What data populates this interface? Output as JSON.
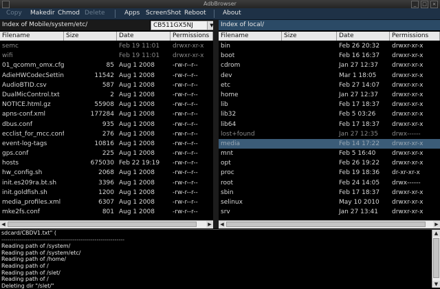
{
  "window": {
    "title": "AdbBrowser"
  },
  "menu": {
    "copy": "Copy",
    "makedir": "Makedir",
    "chmod": "Chmod",
    "delete": "Delete",
    "apps": "Apps",
    "screenshot": "ScreenShot",
    "reboot": "Reboot",
    "about": "About"
  },
  "left": {
    "path": "Index of Mobile/system/etc/",
    "device": "CB511GX5NJ",
    "headers": {
      "filename": "Filename",
      "size": "Size",
      "date": "Date",
      "permissions": "Permissions"
    },
    "rows": [
      {
        "name": "semc",
        "size": "",
        "date": "Feb 19 11:01",
        "perm": "drwxr-xr-x",
        "dim": true
      },
      {
        "name": "wifi",
        "size": "",
        "date": "Feb 19 11:01",
        "perm": "drwxr-xr-x",
        "dim": true
      },
      {
        "name": "01_qcomm_omx.cfg",
        "size": "85",
        "date": "Aug  1  2008",
        "perm": "-rw-r--r--"
      },
      {
        "name": "AdieHWCodecSetting",
        "size": "11542",
        "date": "Aug  1  2008",
        "perm": "-rw-r--r--"
      },
      {
        "name": "AudioBTID.csv",
        "size": "587",
        "date": "Aug  1  2008",
        "perm": "-rw-r--r--"
      },
      {
        "name": "DualMicControl.txt",
        "size": "2",
        "date": "Aug  1  2008",
        "perm": "-rw-r--r--"
      },
      {
        "name": "NOTICE.html.gz",
        "size": "55908",
        "date": "Aug  1  2008",
        "perm": "-rw-r--r--"
      },
      {
        "name": "apns-conf.xml",
        "size": "177284",
        "date": "Aug  1  2008",
        "perm": "-rw-r--r--"
      },
      {
        "name": "dbus.conf",
        "size": "935",
        "date": "Aug  1  2008",
        "perm": "-rw-r--r--"
      },
      {
        "name": "ecclist_for_mcc.conf",
        "size": "276",
        "date": "Aug  1  2008",
        "perm": "-rw-r--r--"
      },
      {
        "name": "event-log-tags",
        "size": "10816",
        "date": "Aug  1  2008",
        "perm": "-rw-r--r--"
      },
      {
        "name": "gps.conf",
        "size": "225",
        "date": "Aug  1  2008",
        "perm": "-rw-r--r--"
      },
      {
        "name": "hosts",
        "size": "675030",
        "date": "Feb 22 19:19",
        "perm": "-rw-r--r--"
      },
      {
        "name": "hw_config.sh",
        "size": "2068",
        "date": "Aug  1  2008",
        "perm": "-rw-r--r--"
      },
      {
        "name": "init.es209ra.bt.sh",
        "size": "3396",
        "date": "Aug  1  2008",
        "perm": "-rw-r--r--"
      },
      {
        "name": "init.goldfish.sh",
        "size": "1200",
        "date": "Aug  1  2008",
        "perm": "-rw-r--r--"
      },
      {
        "name": "media_profiles.xml",
        "size": "6307",
        "date": "Aug  1  2008",
        "perm": "-rw-r--r--"
      },
      {
        "name": "mke2fs.conf",
        "size": "801",
        "date": "Aug  1  2008",
        "perm": "-rw-r--r--"
      }
    ]
  },
  "right": {
    "path": "Index of local/",
    "headers": {
      "filename": "Filename",
      "size": "Size",
      "date": "Date",
      "permissions": "Permissions"
    },
    "rows": [
      {
        "name": "bin",
        "date": "Feb 26 20:32",
        "perm": "drwxr-xr-x"
      },
      {
        "name": "boot",
        "date": "Feb 16 16:37",
        "perm": "drwxr-xr-x"
      },
      {
        "name": "cdrom",
        "date": "Jan 27 12:37",
        "perm": "drwxr-xr-x"
      },
      {
        "name": "dev",
        "date": "Mar  1 18:05",
        "perm": "drwxr-xr-x"
      },
      {
        "name": "etc",
        "date": "Feb 27 14:07",
        "perm": "drwxr-xr-x"
      },
      {
        "name": "home",
        "date": "Jan 27 12:37",
        "perm": "drwxr-xr-x"
      },
      {
        "name": "lib",
        "date": "Feb 17 18:37",
        "perm": "drwxr-xr-x"
      },
      {
        "name": "lib32",
        "date": "Feb  5 03:26",
        "perm": "drwxr-xr-x"
      },
      {
        "name": "lib64",
        "date": "Feb 17 18:37",
        "perm": "drwxr-xr-x"
      },
      {
        "name": "lost+found",
        "date": "Jan 27 12:35",
        "perm": "drwx------",
        "dim": true
      },
      {
        "name": "media",
        "date": "Feb 14 17:22",
        "perm": "drwxr-xr-x",
        "sel": true
      },
      {
        "name": "mnt",
        "date": "Feb  5 16:40",
        "perm": "drwxr-xr-x"
      },
      {
        "name": "opt",
        "date": "Feb 26 19:22",
        "perm": "drwxr-xr-x"
      },
      {
        "name": "proc",
        "date": "Feb 19 18:36",
        "perm": "dr-xr-xr-x"
      },
      {
        "name": "root",
        "date": "Feb 24 14:05",
        "perm": "drwx------"
      },
      {
        "name": "sbin",
        "date": "Feb 17 18:37",
        "perm": "drwxr-xr-x"
      },
      {
        "name": "selinux",
        "date": "May 10  2010",
        "perm": "drwxr-xr-x"
      },
      {
        "name": "srv",
        "date": "Jan 27 13:41",
        "perm": "drwxr-xr-x"
      }
    ]
  },
  "log": {
    "lines": [
      "sdcard/CBDV1.txt\" (",
      "--------------------------------------------------------------",
      "Reading path of /system/",
      "Reading path of /system/etc/",
      "Reading path of /home/",
      "Reading path of /",
      "Reading path of /slet/",
      "Reading path of /",
      "Deleting dir \"/slet/\""
    ]
  },
  "colors": {
    "menubar": "#1e3146",
    "path_left_bg": "#1a1a1a",
    "path_right_bg": "#2b4a66",
    "selection": "#3b5c78",
    "file_text": "#d8d8d8",
    "dim_text": "#8a8a8a"
  }
}
